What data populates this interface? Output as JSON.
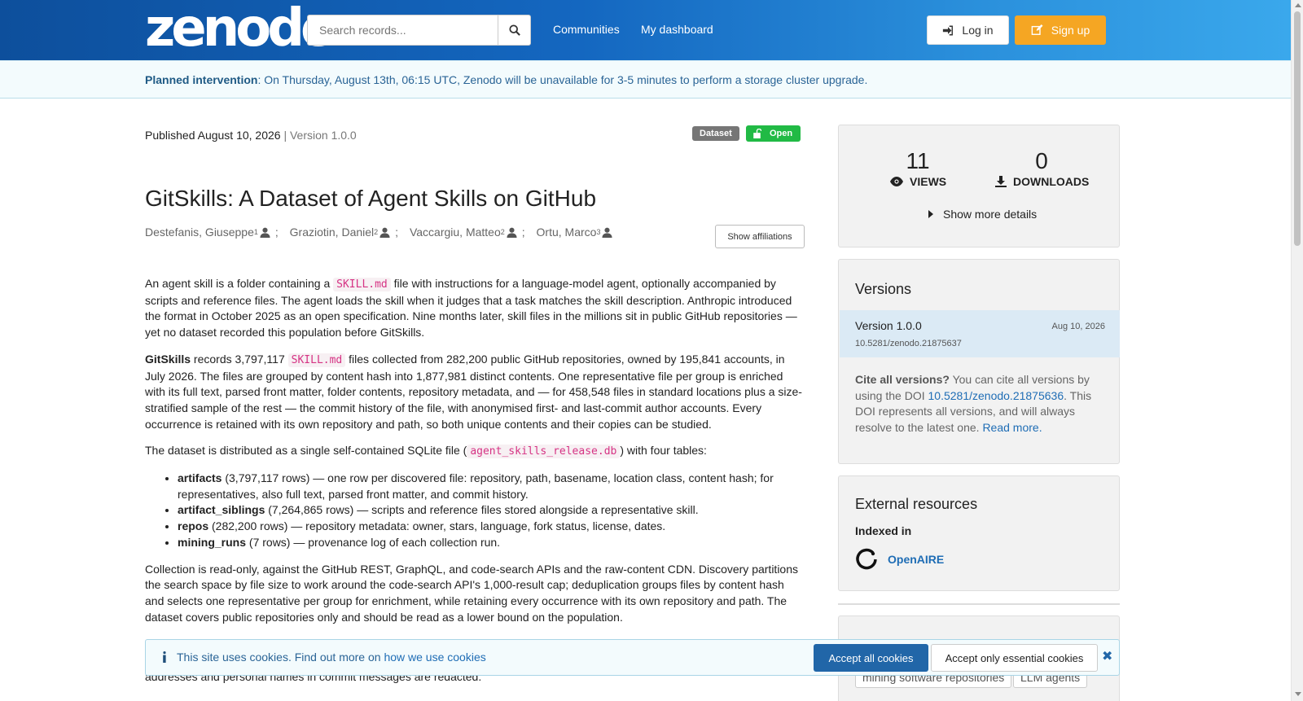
{
  "header": {
    "logo": "zenodo",
    "search_placeholder": "Search records...",
    "nav": [
      "Communities",
      "My dashboard"
    ],
    "login_label": "Log in",
    "signup_label": "Sign up"
  },
  "banner": {
    "label": "Planned intervention",
    "text": ": On Thursday, August 13th, 06:15 UTC, Zenodo will be unavailable for 3-5 minutes to perform a storage cluster upgrade."
  },
  "record": {
    "published": "Published August 10, 2026",
    "version": "| Version 1.0.0",
    "type_badge": "Dataset",
    "access_badge": "Open",
    "title": "GitSkills: A Dataset of Agent Skills on GitHub",
    "authors": [
      {
        "name": "Destefanis, Giuseppe",
        "aff": "1"
      },
      {
        "name": "Graziotin, Daniel",
        "aff": "2"
      },
      {
        "name": "Vaccargiu, Matteo",
        "aff": "2"
      },
      {
        "name": "Ortu, Marco",
        "aff": "3"
      }
    ],
    "show_affiliations": "Show affiliations"
  },
  "description": {
    "p1_a": "An agent skill is a folder containing a ",
    "p1_code": "SKILL.md",
    "p1_b": " file with instructions for a language-model agent, optionally accompanied by scripts and reference files. The agent loads the skill when it judges that a task matches the skill description. Anthropic introduced the format in October 2025 as an open specification. Nine months later, skill files in the millions sit in public GitHub repositories — yet no dataset recorded this population before GitSkills.",
    "p2_bold": "GitSkills",
    "p2_a": " records 3,797,117 ",
    "p2_code": "SKILL.md",
    "p2_b": " files collected from 282,200 public GitHub repositories, owned by 195,841 accounts, in July 2026. The files are grouped by content hash into 1,877,981 distinct contents. One representative file per group is enriched with its full text, parsed front matter, folder contents, repository metadata, and — for 458,548 files in standard locations plus a size-stratified sample of the rest — the commit history of the file, with anonymised first- and last-commit author accounts. Every occurrence is retained with its own repository and path, so both unique contents and their copies can be studied.",
    "p3_a": "The dataset is distributed as a single self-contained SQLite file (",
    "p3_code": "agent_skills_release.db",
    "p3_b": ") with four tables:",
    "tables": [
      {
        "name": "artifacts",
        "text": " (3,797,117 rows) — one row per discovered file: repository, path, basename, location class, content hash; for representatives, also full text, parsed front matter, and commit history."
      },
      {
        "name": "artifact_siblings",
        "text": " (7,264,865 rows) — scripts and reference files stored alongside a representative skill."
      },
      {
        "name": "repos",
        "text": " (282,200 rows) — repository metadata: owner, stars, language, fork status, license, dates."
      },
      {
        "name": "mining_runs",
        "text": " (7 rows) — provenance log of each collection run."
      }
    ],
    "p4": "Collection is read-only, against the GitHub REST, GraphQL, and code-search APIs and the raw-content CDN. Discovery partitions the search space by file size to work around the code-search API's 1,000-result cap; deduplication groups files by content hash and selects one representative per group for enrichment, while retaining every occurrence with its own repository and path. The dataset covers public repositories only and should be read as a lower bound on the population.",
    "tail": "addresses and personal names in commit messages are redacted."
  },
  "stats": {
    "views": "11",
    "views_label": "VIEWS",
    "downloads": "0",
    "downloads_label": "DOWNLOADS",
    "more": "Show more details"
  },
  "versions": {
    "title": "Versions",
    "current_name": "Version 1.0.0",
    "current_date": "Aug 10, 2026",
    "current_doi": "10.5281/zenodo.21875637",
    "cite_bold": "Cite all versions?",
    "cite_a": " You can cite all versions by using the DOI ",
    "cite_doi": "10.5281/zenodo.21875636",
    "cite_b": ". This DOI represents all versions, and will always resolve to the latest one. ",
    "read_more": "Read more."
  },
  "external": {
    "title": "External resources",
    "indexed_in": "Indexed in",
    "openaire": "OpenAIRE"
  },
  "keywords": [
    "mining software repositories",
    "LLM agents"
  ],
  "cookie": {
    "text": "This site uses cookies. Find out more on ",
    "link": "how we use cookies",
    "accept_all": "Accept all cookies",
    "accept_essential": "Accept only essential cookies"
  }
}
